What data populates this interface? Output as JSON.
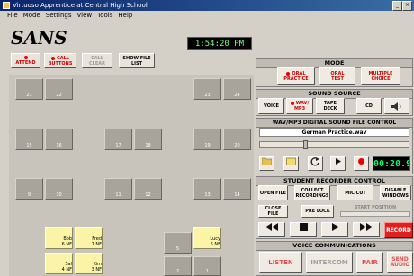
{
  "window": {
    "title": "Virtuoso Apprentice at Central High School"
  },
  "menu": [
    "File",
    "Mode",
    "Settings",
    "View",
    "Tools",
    "Help"
  ],
  "header": {
    "logo": "SANS",
    "clock": "1:54:20 PM"
  },
  "toolbar": {
    "attend": "ATTEND",
    "call_buttons_1": "CALL",
    "call_buttons_2": "BUTTONS",
    "call_clear_1": "CALL",
    "call_clear_2": "CLEAR",
    "show_file_list_1": "SHOW FILE",
    "show_file_list_2": "LIST"
  },
  "seats": [
    {
      "label": "21"
    },
    {
      "label": "22"
    },
    {
      "label": "23"
    },
    {
      "label": "24"
    },
    {
      "label": "15"
    },
    {
      "label": "16"
    },
    {
      "label": "17"
    },
    {
      "label": "18"
    },
    {
      "label": "19"
    },
    {
      "label": "20"
    },
    {
      "label": "9"
    },
    {
      "label": "10"
    },
    {
      "label": "11"
    },
    {
      "label": "12"
    },
    {
      "label": "13"
    },
    {
      "label": "14"
    },
    {
      "label": "5"
    },
    {
      "label": "2"
    },
    {
      "label": "1"
    }
  ],
  "students": [
    {
      "name": "Bob",
      "channel": "6 NF"
    },
    {
      "name": "Fred",
      "channel": "7 NF"
    },
    {
      "name": "Sal",
      "channel": "4 NF"
    },
    {
      "name": "Kim",
      "channel": "3 NF"
    },
    {
      "name": "Lucy",
      "channel": "6 NF"
    }
  ],
  "mode": {
    "title": "MODE",
    "oral_practice_1": "ORAL",
    "oral_practice_2": "PRACTICE",
    "oral_test_1": "ORAL",
    "oral_test_2": "TEST",
    "multiple_choice_1": "MULTIPLE",
    "multiple_choice_2": "CHOICE"
  },
  "sound_source": {
    "title": "SOUND SOURCE",
    "voice": "VOICE",
    "wav_1": "WAV/",
    "wav_2": "MP3",
    "tape_1": "TAPE",
    "tape_2": "DECK",
    "cd": "CD"
  },
  "wav_control": {
    "title": "WAV/MP3 DIGITAL SOUND FILE CONTROL",
    "filename": "German Practice.wav",
    "counter": "00:20.9",
    "position_fraction": 0.3
  },
  "recorder": {
    "title": "STUDENT RECORDER CONTROL",
    "open_file": "OPEN FILE",
    "collect_1": "COLLECT",
    "collect_2": "RECORDINGS",
    "mic_cut": "MIC CUT",
    "disable_1": "DISABLE",
    "disable_2": "WINDOWS",
    "close_file": "CLOSE FILE",
    "pre_lock": "PRE LOCK",
    "start_position": "START POSITION",
    "record": "RECORD"
  },
  "voice_comm": {
    "title": "VOICE COMMUNICATIONS",
    "listen": "LISTEN",
    "intercom": "INTERCOM",
    "pair": "PAIR",
    "send_1": "SEND",
    "send_2": "AUDIO"
  },
  "colors": {
    "record": "#e02020",
    "counter": "#00ff66",
    "seat_active": "#fbf4a6"
  }
}
